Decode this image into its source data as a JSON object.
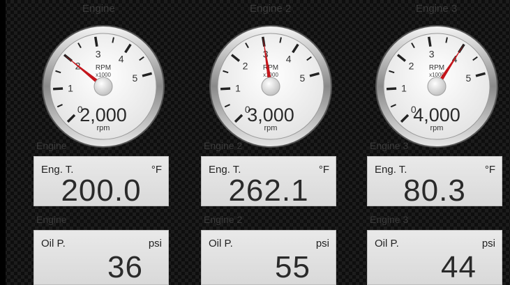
{
  "engines": [
    {
      "header": "Engine",
      "gauge": {
        "caption": "RPM",
        "multiplier": "x1000",
        "ticks": [
          "0",
          "1",
          "2",
          "3",
          "4",
          "5"
        ],
        "readout": "2,000",
        "unit": "rpm",
        "value_rpm": 2000,
        "needle_color": "#c4161c"
      },
      "temp": {
        "section_label": "Engine",
        "label": "Eng. T.",
        "unit": "°F",
        "value": "200.0"
      },
      "oil": {
        "section_label": "Engine",
        "label": "Oil P.",
        "unit": "psi",
        "value": "36"
      }
    },
    {
      "header": "Engine 2",
      "gauge": {
        "caption": "RPM",
        "multiplier": "x1000",
        "ticks": [
          "0",
          "1",
          "2",
          "3",
          "4",
          "5"
        ],
        "readout": "3,000",
        "unit": "rpm",
        "value_rpm": 3000,
        "needle_color": "#c4161c"
      },
      "temp": {
        "section_label": "Engine 2",
        "label": "Eng. T.",
        "unit": "°F",
        "value": "262.1"
      },
      "oil": {
        "section_label": "Engine 2",
        "label": "Oil P.",
        "unit": "psi",
        "value": "55"
      }
    },
    {
      "header": "Engine 3",
      "gauge": {
        "caption": "RPM",
        "multiplier": "x1000",
        "ticks": [
          "0",
          "1",
          "2",
          "3",
          "4",
          "5"
        ],
        "readout": "4,000",
        "unit": "rpm",
        "value_rpm": 4000,
        "needle_color": "#c4161c"
      },
      "temp": {
        "section_label": "Engine 3",
        "label": "Eng. T.",
        "unit": "°F",
        "value": "80.3"
      },
      "oil": {
        "section_label": "Engine 3",
        "label": "Oil P.",
        "unit": "psi",
        "value": "44"
      }
    }
  ]
}
